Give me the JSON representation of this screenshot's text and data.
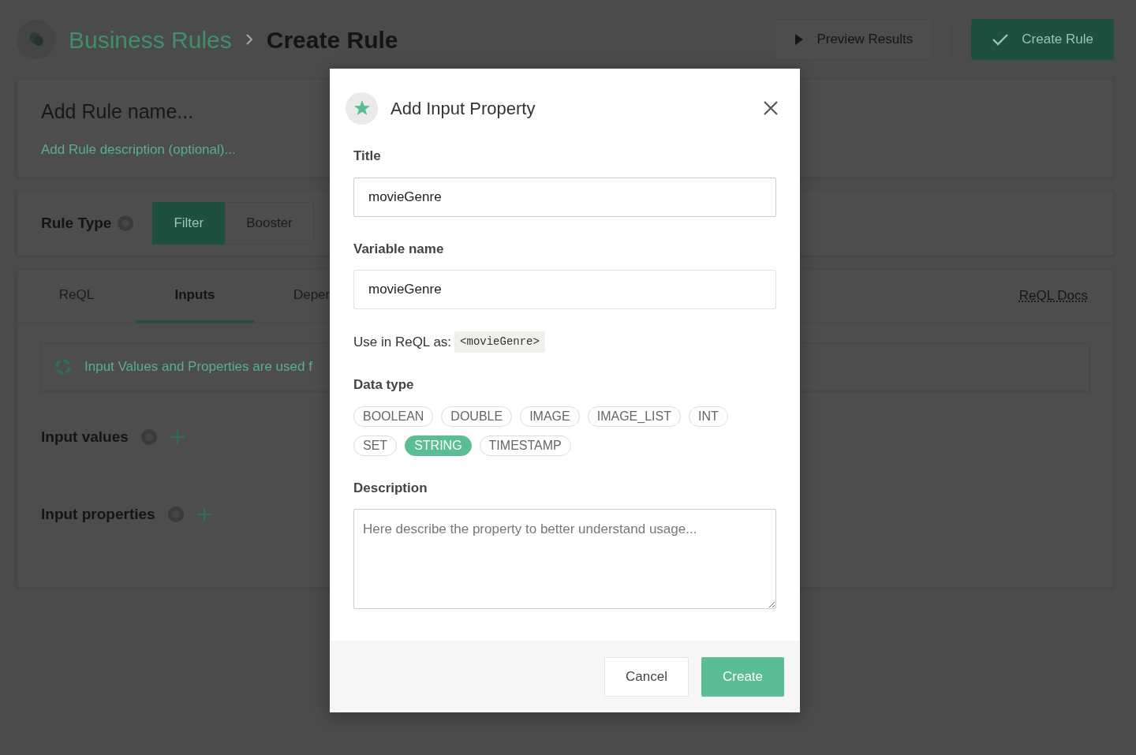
{
  "header": {
    "breadcrumb": [
      {
        "label": "Business Rules",
        "kind": "link"
      },
      {
        "label": "Create Rule",
        "kind": "current"
      }
    ],
    "preview_button": "Preview Results",
    "create_button": "Create Rule"
  },
  "rule_card": {
    "name_placeholder": "Add Rule name...",
    "description_placeholder": "Add Rule description (optional)..."
  },
  "rule_type": {
    "label": "Rule Type",
    "options": [
      {
        "label": "Filter",
        "selected": true
      },
      {
        "label": "Booster",
        "selected": false
      }
    ]
  },
  "tabs": [
    {
      "label": "ReQL",
      "selected": false
    },
    {
      "label": "Inputs",
      "selected": true
    },
    {
      "label": "Depen",
      "selected": false
    }
  ],
  "docs_link": "ReQL Docs",
  "info": "Input Values and Properties are used f",
  "sections": [
    {
      "title": "Input values"
    },
    {
      "title": "Input properties"
    }
  ],
  "modal": {
    "title": "Add Input Property",
    "title_field": {
      "label": "Title",
      "value": "movieGenre"
    },
    "variable_field": {
      "label": "Variable name",
      "value": "movieGenre"
    },
    "usage": {
      "label": "Use in ReQL as:",
      "code": "<movieGenre>"
    },
    "data_type": {
      "label": "Data type",
      "options": [
        {
          "label": "BOOLEAN",
          "selected": false
        },
        {
          "label": "DOUBLE",
          "selected": false
        },
        {
          "label": "IMAGE",
          "selected": false
        },
        {
          "label": "IMAGE_LIST",
          "selected": false
        },
        {
          "label": "INT",
          "selected": false
        },
        {
          "label": "SET",
          "selected": false
        },
        {
          "label": "STRING",
          "selected": true
        },
        {
          "label": "TIMESTAMP",
          "selected": false
        }
      ]
    },
    "description": {
      "label": "Description",
      "placeholder": "Here describe the property to better understand usage..."
    },
    "buttons": [
      {
        "label": "Cancel",
        "kind": "secondary"
      },
      {
        "label": "Create",
        "kind": "primary"
      }
    ]
  }
}
